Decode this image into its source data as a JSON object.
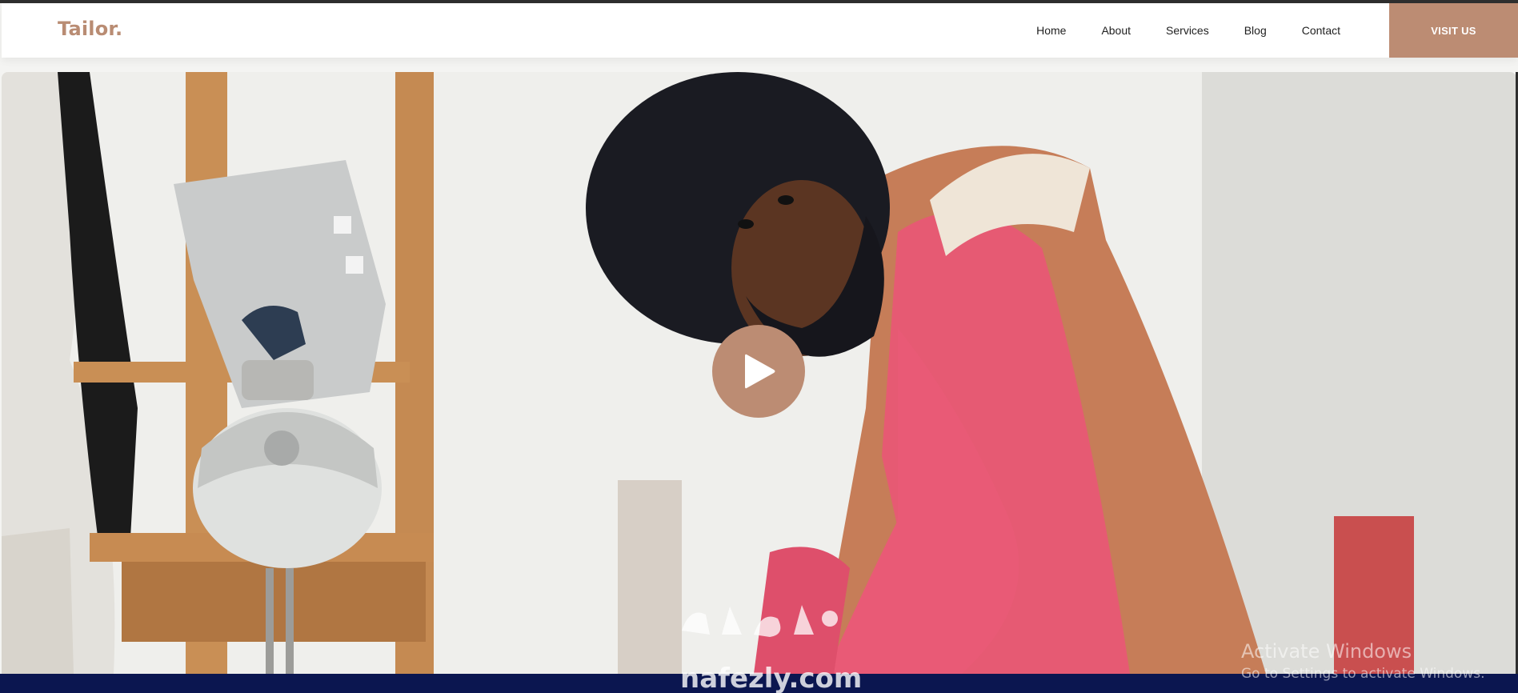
{
  "brand": {
    "logo": "Tailor."
  },
  "nav": {
    "items": [
      "Home",
      "About",
      "Services",
      "Blog",
      "Contact"
    ],
    "cta_label": "VISIT US"
  },
  "hero": {
    "media_type": "video",
    "play_icon": "play-icon"
  },
  "watermark": {
    "text": "nafezly.com"
  },
  "windows_notice": {
    "title": "Activate Windows",
    "subtitle": "Go to Settings to activate Windows."
  },
  "colors": {
    "accent": "#bc8c73",
    "logo": "#b98c73",
    "footer": "#0b1650"
  }
}
